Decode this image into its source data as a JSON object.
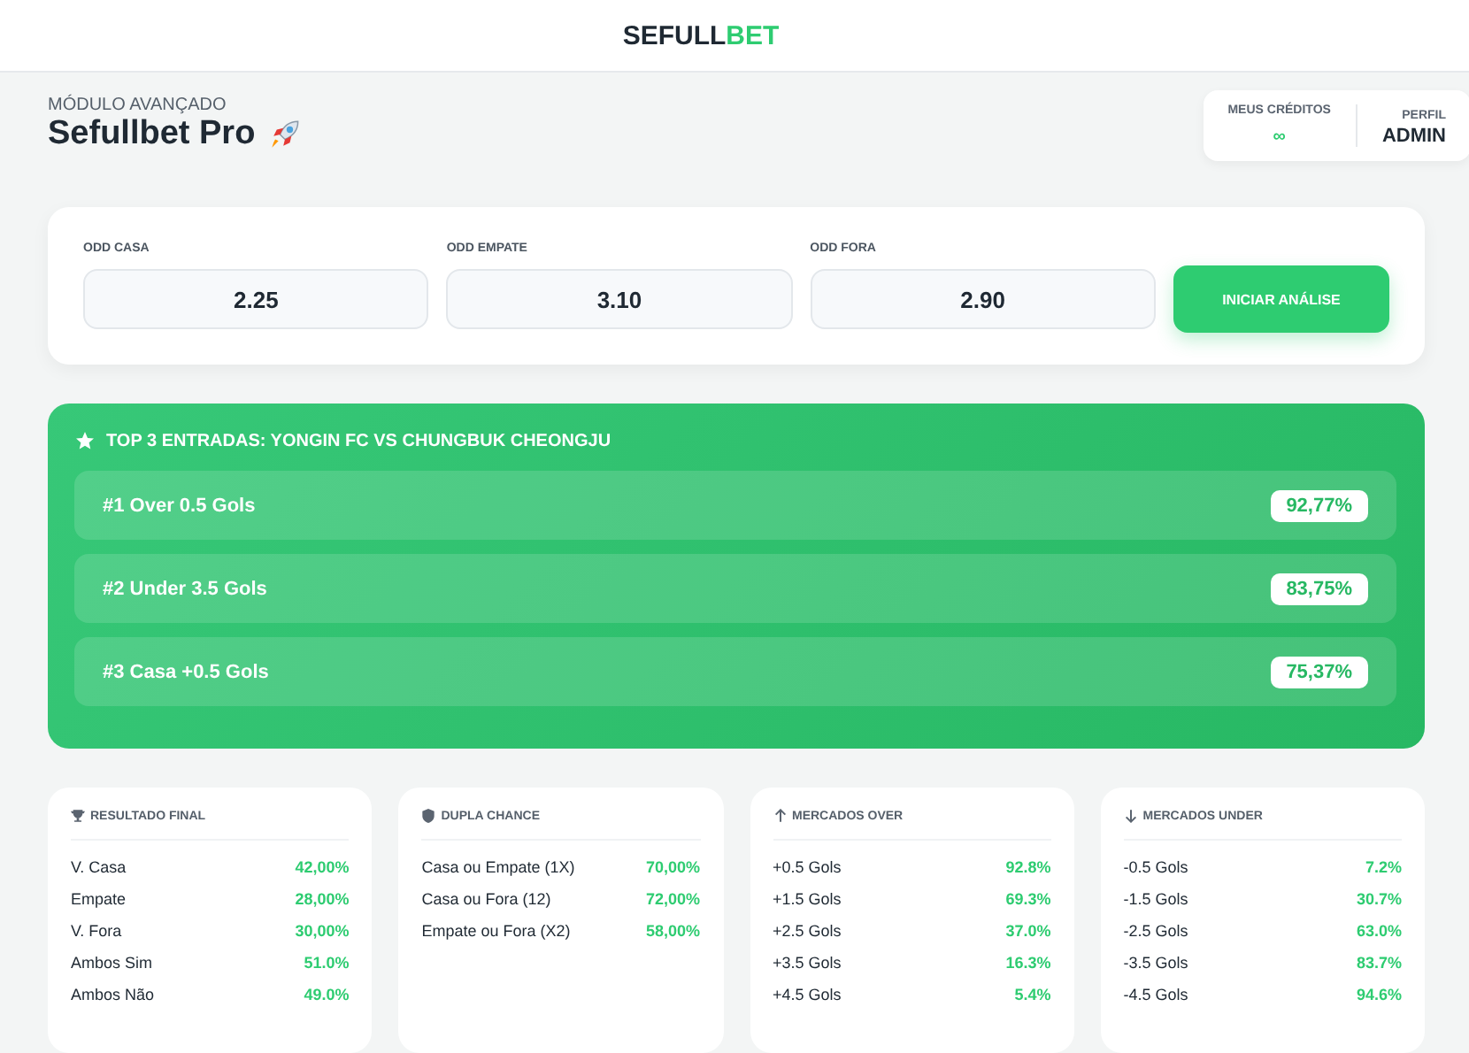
{
  "brand": {
    "dark": "SEFULL",
    "accent": "BET"
  },
  "header": {
    "eyebrow": "MÓDULO AVANÇADO",
    "title": "Sefullbet Pro"
  },
  "account": {
    "credits_label": "MEUS CRÉDITOS",
    "credits_value": "∞",
    "profile_label": "PERFIL",
    "profile_value": "ADMIN"
  },
  "odds": [
    {
      "label": "ODD CASA",
      "value": "2.25"
    },
    {
      "label": "ODD EMPATE",
      "value": "3.10"
    },
    {
      "label": "ODD FORA",
      "value": "2.90"
    }
  ],
  "analyze_button": "INICIAR ANÁLISE",
  "top3": {
    "title": "TOP 3 ENTRADAS: YONGIN FC VS CHUNGBUK CHEONGJU",
    "entries": [
      {
        "label": "#1 Over 0.5 Gols",
        "value": "92,77%"
      },
      {
        "label": "#2 Under 3.5 Gols",
        "value": "83,75%"
      },
      {
        "label": "#3 Casa +0.5 Gols",
        "value": "75,37%"
      }
    ]
  },
  "markets": [
    {
      "title": "RESULTADO FINAL",
      "rows": [
        {
          "label": "V. Casa",
          "value": "42,00%"
        },
        {
          "label": "Empate",
          "value": "28,00%"
        },
        {
          "label": "V. Fora",
          "value": "30,00%"
        },
        {
          "label": "Ambos Sim",
          "value": "51.0%"
        },
        {
          "label": "Ambos Não",
          "value": "49.0%"
        }
      ]
    },
    {
      "title": "DUPLA CHANCE",
      "rows": [
        {
          "label": "Casa ou Empate (1X)",
          "value": "70,00%"
        },
        {
          "label": "Casa ou Fora (12)",
          "value": "72,00%"
        },
        {
          "label": "Empate ou Fora (X2)",
          "value": "58,00%"
        }
      ]
    },
    {
      "title": "MERCADOS OVER",
      "rows": [
        {
          "label": "+0.5 Gols",
          "value": "92.8%"
        },
        {
          "label": "+1.5 Gols",
          "value": "69.3%"
        },
        {
          "label": "+2.5 Gols",
          "value": "37.0%"
        },
        {
          "label": "+3.5 Gols",
          "value": "16.3%"
        },
        {
          "label": "+4.5 Gols",
          "value": "5.4%"
        }
      ]
    },
    {
      "title": "MERCADOS UNDER",
      "rows": [
        {
          "label": "-0.5 Gols",
          "value": "7.2%"
        },
        {
          "label": "-1.5 Gols",
          "value": "30.7%"
        },
        {
          "label": "-2.5 Gols",
          "value": "63.0%"
        },
        {
          "label": "-3.5 Gols",
          "value": "83.7%"
        },
        {
          "label": "-4.5 Gols",
          "value": "94.6%"
        }
      ]
    }
  ]
}
